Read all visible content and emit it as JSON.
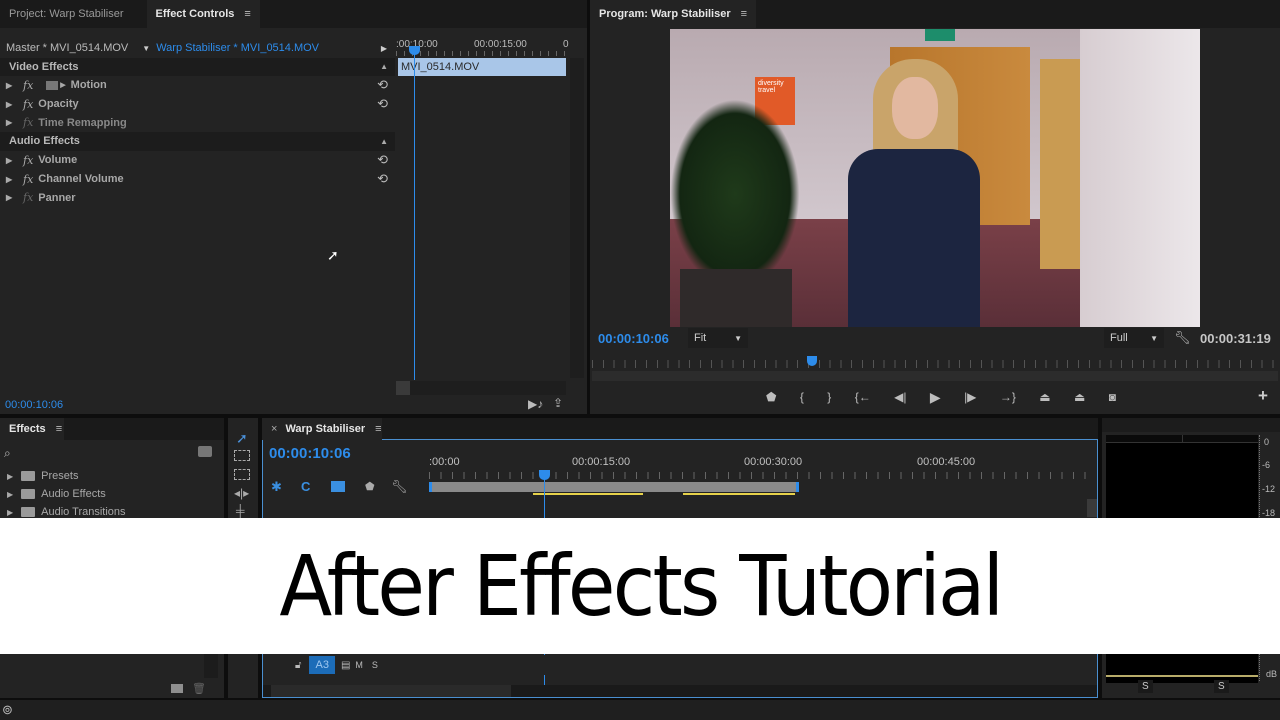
{
  "effect_controls": {
    "tabs": [
      {
        "label": "Project: Warp Stabiliser",
        "active": false
      },
      {
        "label": "Effect Controls",
        "active": true
      }
    ],
    "menu_glyph": "≡",
    "source_master": "Master * MVI_0514.MOV",
    "source_sequence": "Warp Stabiliser * MVI_0514.MOV",
    "ruler": {
      "t1": ":00:10:00",
      "t2": "00:00:15:00",
      "t3": "0"
    },
    "clip_name": "MVI_0514.MOV",
    "sections": [
      {
        "title": "Video Effects",
        "items": [
          {
            "label": "Motion",
            "resettable": true,
            "enabled": true
          },
          {
            "label": "Opacity",
            "resettable": true,
            "enabled": true
          },
          {
            "label": "Time Remapping",
            "resettable": false,
            "enabled": false
          }
        ]
      },
      {
        "title": "Audio Effects",
        "items": [
          {
            "label": "Volume",
            "resettable": true,
            "enabled": true
          },
          {
            "label": "Channel Volume",
            "resettable": true,
            "enabled": true
          },
          {
            "label": "Panner",
            "resettable": false,
            "enabled": false
          }
        ]
      }
    ],
    "fx_glyph": "fx",
    "reset_glyph": "⟲",
    "timecode": "00:00:10:06"
  },
  "program_monitor": {
    "tab_label": "Program: Warp Stabiliser",
    "menu_glyph": "≡",
    "current_timecode": "00:00:10:06",
    "zoom_select": "Fit",
    "resolution_select": "Full",
    "duration_timecode": "00:00:31:19",
    "video": {
      "sign_text": "diversity travel"
    },
    "playhead_fraction": 0.32,
    "transport": [
      {
        "name": "add-marker-button",
        "glyph": "⬟"
      },
      {
        "name": "mark-in-button",
        "glyph": "{"
      },
      {
        "name": "mark-out-button",
        "glyph": "}"
      },
      {
        "name": "go-to-in-button",
        "glyph": "{←"
      },
      {
        "name": "step-back-button",
        "glyph": "◀|"
      },
      {
        "name": "play-button",
        "glyph": "▶"
      },
      {
        "name": "step-forward-button",
        "glyph": "|▶"
      },
      {
        "name": "go-to-out-button",
        "glyph": "→}"
      },
      {
        "name": "lift-button",
        "glyph": "⏏"
      },
      {
        "name": "extract-button",
        "glyph": "⏏"
      },
      {
        "name": "export-frame-button",
        "glyph": "◙"
      }
    ],
    "add_button": "+"
  },
  "effects_panel": {
    "tab_label": "Effects",
    "menu_glyph": "≡",
    "search_placeholder": "",
    "items": [
      {
        "label": "Presets"
      },
      {
        "label": "Audio Effects"
      },
      {
        "label": "Audio Transitions"
      }
    ]
  },
  "timeline": {
    "tab_label": "Warp Stabiliser",
    "close_glyph": "×",
    "menu_glyph": "≡",
    "timecode": "00:00:10:06",
    "ruler": [
      ":00:00",
      "00:00:15:00",
      "00:00:30:00",
      "00:00:45:00"
    ],
    "track": {
      "label": "A3",
      "mute": "M",
      "solo": "S"
    }
  },
  "audio_meter": {
    "scale": [
      "0",
      "-6",
      "-12",
      "-18"
    ],
    "unit": "dB",
    "solo_buttons": [
      "S",
      "S"
    ]
  },
  "banner": {
    "text": "After Effects Tutorial"
  }
}
